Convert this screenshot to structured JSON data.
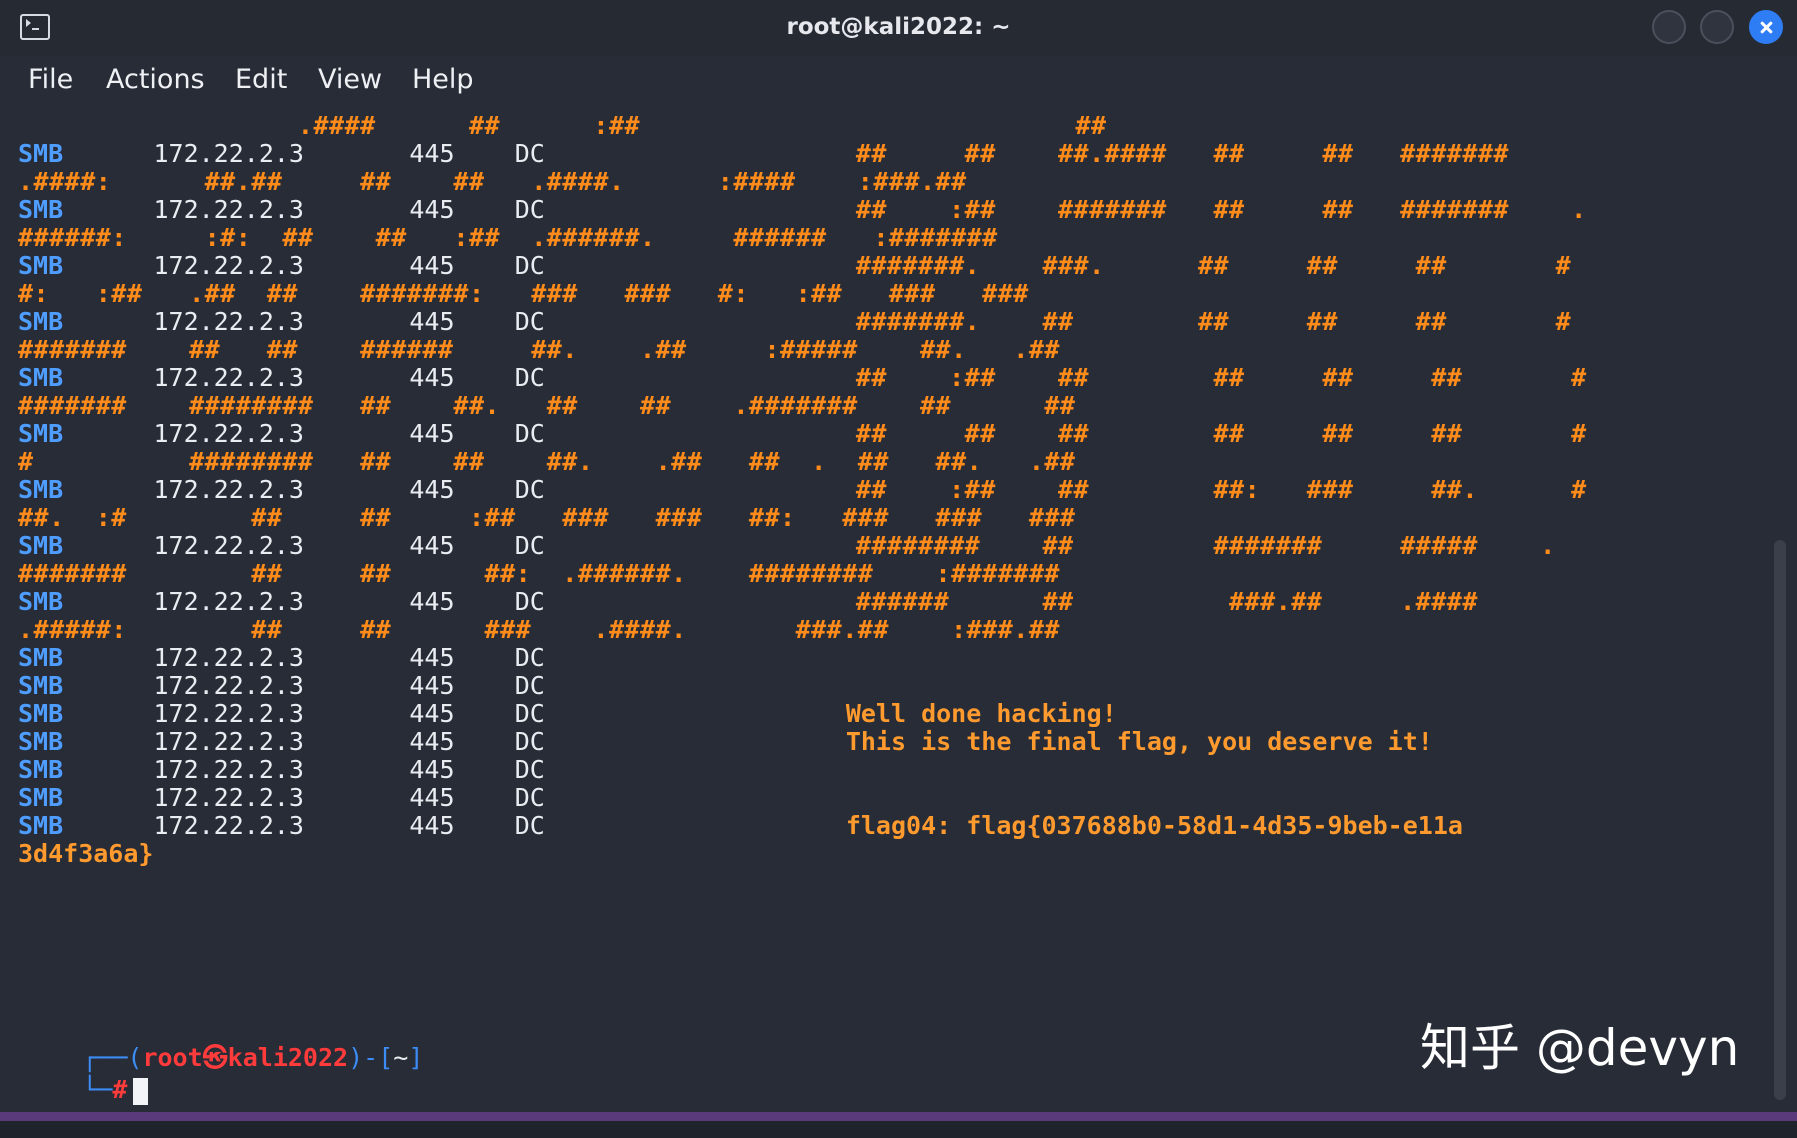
{
  "window": {
    "title": "root@kali2022: ~",
    "buttons": {
      "minimize_icon": "circle",
      "maximize_icon": "circle",
      "close_icon": "x-icon"
    }
  },
  "menu": {
    "items": [
      "File",
      "Actions",
      "Edit",
      "View",
      "Help"
    ]
  },
  "terminal": {
    "lines": [
      {
        "left": "",
        "right": "                  .####      ##      :##                            ##"
      },
      {
        "left": "SMB",
        "right": "      172.22.2.3       445    DC                    ##     ##    ##.####   ##     ##   #######"
      },
      {
        "left": "",
        "right": ".####:      ##.##     ##    ##   .####.      :####    :###.##"
      },
      {
        "left": "SMB",
        "right": "      172.22.2.3       445    DC                    ##    :##    #######   ##     ##   #######    ."
      },
      {
        "left": "",
        "right": "######:     :#:  ##    ##   :##  .######.     ######   :#######"
      },
      {
        "left": "SMB",
        "right": "      172.22.2.3       445    DC                    #######.    ###.      ##     ##     ##       #"
      },
      {
        "left": "",
        "right": "#:   :##   .##  ##    #######:   ###   ###   #:   :##   ###   ###"
      },
      {
        "left": "SMB",
        "right": "      172.22.2.3       445    DC                    #######.    ##        ##     ##     ##       #"
      },
      {
        "left": "",
        "right": "#######    ##   ##    ######     ##.    .##     :#####    ##.   .##"
      },
      {
        "left": "SMB",
        "right": "      172.22.2.3       445    DC                    ##    :##    ##        ##     ##     ##       #"
      },
      {
        "left": "",
        "right": "#######    ########   ##    ##.   ##    ##    .#######    ##      ##"
      },
      {
        "left": "SMB",
        "right": "      172.22.2.3       445    DC                    ##     ##    ##        ##     ##     ##       #"
      },
      {
        "left": "",
        "right": "#          ########   ##    ##    ##.    .##   ##  .  ##   ##.   .##"
      },
      {
        "left": "SMB",
        "right": "      172.22.2.3       445    DC                    ##    :##    ##        ##:   ###     ##.      #"
      },
      {
        "left": "",
        "right": "##.  :#        ##     ##     :##   ###   ###   ##:   ###   ###   ###"
      },
      {
        "left": "SMB",
        "right": "      172.22.2.3       445    DC                    ########    ##         #######     #####    ."
      },
      {
        "left": "",
        "right": "#######        ##     ##      ##:  .######.    ########    :#######"
      },
      {
        "left": "SMB",
        "right": "      172.22.2.3       445    DC                    ######      ##          ###.##     .####"
      },
      {
        "left": "",
        "right": ".#####:        ##     ##      ###    .####.       ###.##    :###.##"
      },
      {
        "left": "SMB",
        "right": "      172.22.2.3       445    DC"
      },
      {
        "left": "SMB",
        "right": "      172.22.2.3       445    DC"
      },
      {
        "left": "SMB",
        "right": "      172.22.2.3       445    DC                    Well done hacking!"
      },
      {
        "left": "SMB",
        "right": "      172.22.2.3       445    DC                    This is the final flag, you deserve it!"
      },
      {
        "left": "SMB",
        "right": "      172.22.2.3       445    DC"
      },
      {
        "left": "SMB",
        "right": "      172.22.2.3       445    DC"
      },
      {
        "left": "SMB",
        "right": "      172.22.2.3       445    DC                    flag04: flag{037688b0-58d1-4d35-9beb-e11a"
      },
      {
        "left": "",
        "right": "3d4f3a6a}"
      }
    ],
    "prompt": {
      "line1_prefix": "┌──(",
      "user": "root",
      "at": "㉿",
      "host": "kali2022",
      "line1_mid": ")-[",
      "path": "~",
      "line1_suffix": "]",
      "line2_prefix": "└─",
      "hash": "#"
    }
  },
  "watermark": "知乎 @devyn"
}
